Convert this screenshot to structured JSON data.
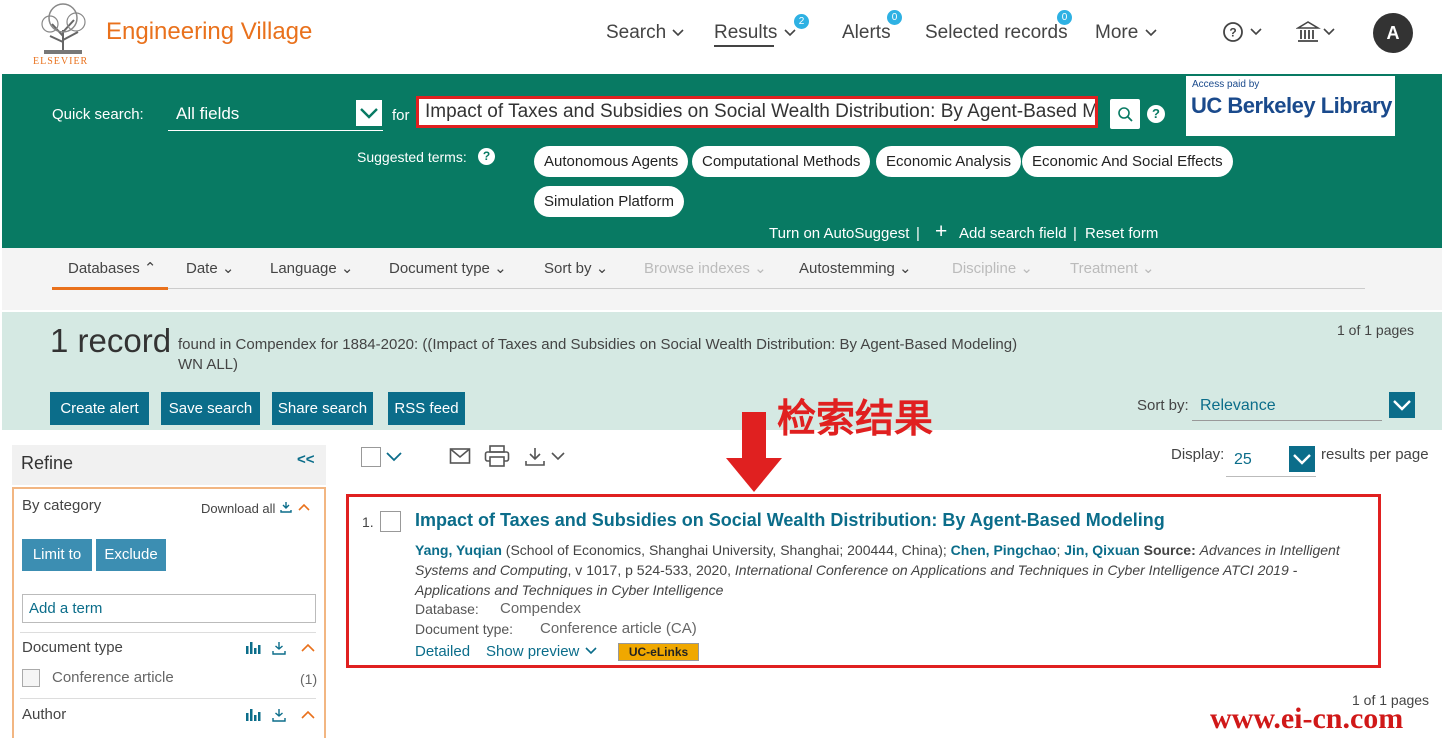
{
  "header": {
    "brand": "Engineering Village",
    "publisher": "ELSEVIER",
    "nav": {
      "search": "Search",
      "results": "Results",
      "results_badge": "2",
      "alerts": "Alerts",
      "alerts_badge": "0",
      "selected": "Selected records",
      "selected_badge": "0",
      "more": "More"
    },
    "avatar": "A"
  },
  "search": {
    "label": "Quick search:",
    "field": "All fields",
    "for": "for",
    "query": "Impact of Taxes and Subsidies on Social Wealth Distribution: By Agent-Based Modeling",
    "library_paid": "Access paid by",
    "library_name": "UC Berkeley Library",
    "suggested_label": "Suggested terms:",
    "suggested_terms": [
      "Autonomous Agents",
      "Computational Methods",
      "Economic Analysis",
      "Economic And Social Effects",
      "Simulation Platform"
    ],
    "autosuggest": "Turn on AutoSuggest",
    "add_field": "Add search field",
    "reset": "Reset form"
  },
  "filters": [
    "Databases",
    "Date",
    "Language",
    "Document type",
    "Sort by",
    "Browse indexes",
    "Autostemming",
    "Discipline",
    "Treatment"
  ],
  "summary": {
    "count": "1 record",
    "description": "found in Compendex for 1884-2020: ((Impact of Taxes and Subsidies on Social Wealth Distribution: By Agent-Based Modeling) WN ALL)",
    "pages": "1 of 1 pages",
    "buttons": [
      "Create alert",
      "Save search",
      "Share search",
      "RSS feed"
    ],
    "sort_label": "Sort by:",
    "sort_value": "Relevance"
  },
  "annotation": "检索结果",
  "refine": {
    "title": "Refine",
    "collapse": "<<",
    "by_category": "By category",
    "download_all": "Download all",
    "limit": "Limit to",
    "exclude": "Exclude",
    "add_term": "Add a term",
    "doc_type": "Document type",
    "facet_label": "Conference article",
    "facet_count": "(1)",
    "author": "Author"
  },
  "toolbar": {
    "display_label": "Display:",
    "display_value": "25",
    "per_page": "results per page"
  },
  "result": {
    "num": "1.",
    "title": "Impact of Taxes and Subsidies on Social Wealth Distribution: By Agent-Based Modeling",
    "author1": "Yang, Yuqian",
    "affil": " (School of Economics, Shanghai University, Shanghai; 200444, China); ",
    "author2": "Chen, Pingchao",
    "author3": "Jin, Qixuan",
    "source_label": " Source: ",
    "source_journal": "Advances in Intelligent Systems and Computing",
    "source_detail": ", v 1017, p 524-533, 2020, ",
    "conference": "International Conference on Applications and Techniques in Cyber Intelligence ATCI 2019 - Applications and Techniques in Cyber Intelligence",
    "db_label": "Database:",
    "db_value": "Compendex",
    "doctype_label": "Document type:",
    "doctype_value": "Conference article (CA)",
    "detailed": "Detailed",
    "preview": "Show preview",
    "uc_elinks": "UC-eLinks"
  },
  "footer": {
    "pages": "1 of 1 pages",
    "watermark": "www.ei-cn.com"
  }
}
